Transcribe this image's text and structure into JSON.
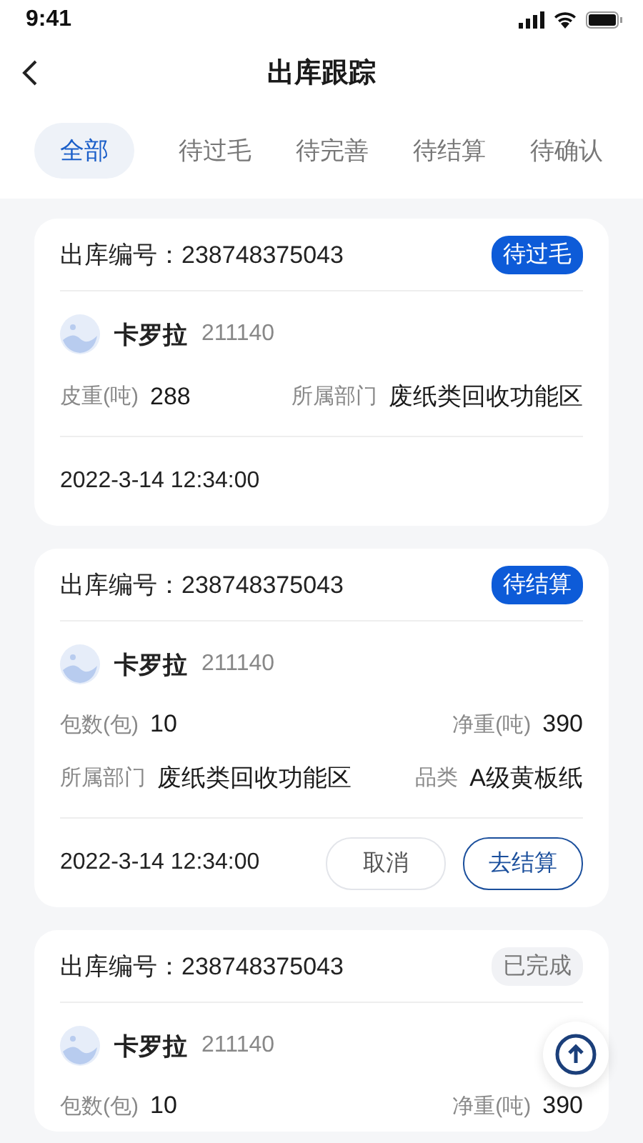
{
  "status_bar": {
    "time": "9:41"
  },
  "header": {
    "title": "出库跟踪"
  },
  "tabs": [
    {
      "label": "全部",
      "selected": true
    },
    {
      "label": "待过毛",
      "selected": false
    },
    {
      "label": "待完善",
      "selected": false
    },
    {
      "label": "待结算",
      "selected": false
    },
    {
      "label": "待确认",
      "selected": false
    }
  ],
  "orders": [
    {
      "number_label": "出库编号：",
      "number": "238748375043",
      "status": {
        "label": "待过毛",
        "kind": "active"
      },
      "person": {
        "name": "卡罗拉",
        "id": "211140"
      },
      "rows": [
        [
          {
            "label": "皮重(吨)",
            "value": "288"
          },
          {
            "label": "所属部门",
            "value": "废纸类回收功能区"
          }
        ]
      ],
      "time": "2022-3-14  12:34:00"
    },
    {
      "number_label": "出库编号：",
      "number": "238748375043",
      "status": {
        "label": "待结算",
        "kind": "active"
      },
      "person": {
        "name": "卡罗拉",
        "id": "211140"
      },
      "rows": [
        [
          {
            "label": "包数(包)",
            "value": "10"
          },
          {
            "label": "净重(吨)",
            "value": "390"
          }
        ],
        [
          {
            "label": "所属部门",
            "value": "废纸类回收功能区"
          },
          {
            "label": "品类",
            "value": "A级黄板纸"
          }
        ]
      ],
      "time": "2022-3-14  12:34:00",
      "actions": [
        {
          "label": "取消",
          "kind": "secondary"
        },
        {
          "label": "去结算",
          "kind": "primary"
        }
      ]
    },
    {
      "number_label": "出库编号：",
      "number": "238748375043",
      "status": {
        "label": "已完成",
        "kind": "done"
      },
      "person": {
        "name": "卡罗拉",
        "id": "211140"
      },
      "rows": [
        [
          {
            "label": "包数(包)",
            "value": "10"
          },
          {
            "label": "净重(吨)",
            "value": "390"
          }
        ]
      ]
    }
  ]
}
